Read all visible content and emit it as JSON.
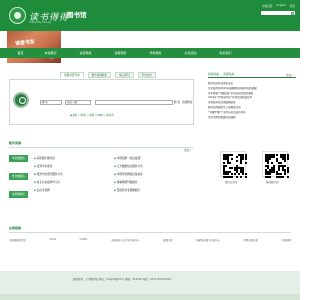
{
  "header": {
    "school_name_cn": "读书得得",
    "school_name_en": "University Library",
    "library_title": "图书馆",
    "top_links": [
      "学校首页",
      "English",
      "登录"
    ],
    "brand_color": "#1f8c3b"
  },
  "banner": {
    "text": "读者书友"
  },
  "nav": {
    "items": [
      "首页",
      "本馆概况",
      "资源导航",
      "读者服务",
      "学科服务",
      "文化活动",
      "联系我们"
    ]
  },
  "search": {
    "tabs": [
      "馆藏书目查询",
      "数字资源检索",
      "电子期刊",
      "学位论文"
    ],
    "field_select": "题 名",
    "match_select": "前方一致",
    "query_value": "",
    "go_label": "检 索",
    "adv_label": "高级检索",
    "types": "◉书名 ○作者 ○主题 ○ISBN ○索书号"
  },
  "digital_lib": {
    "title": "数字资源",
    "buttons": [
      "中文数据库",
      "外文数据库",
      "试用数据库"
    ],
    "more": "更多»",
    "items": [
      "超星数字图书馆",
      "中国知网（知识发现）",
      "读秀学术搜索",
      "万方数据知识服务平台",
      "维普中文期刊服务平台",
      "中国年鉴网络出版总库",
      "新东方多媒体学习库",
      "博看网期刊数据库",
      "起点考试网",
      "国道外文专题数据库"
    ]
  },
  "right": {
    "tabs": [
      "新闻动态",
      "资源动态"
    ],
    "more": "更多»",
    "news": [
      "图书馆召开读者座谈会",
      "关于图书馆2024年暑假期间开放时间的通知",
      "关于开展“书香校园”全民阅读活动的通知",
      "2024年“世界读书日”系列活动获奖名单",
      "读者服务月活动圆满结束",
      "图书馆开展新生入馆教育培训",
      "“书香伴我行”读书分享会成功举办",
      "关于试用新数据库的通知"
    ],
    "qr": [
      "微信公众号",
      "移动图书馆"
    ]
  },
  "friend_links": {
    "title": "友情链接",
    "links": [
      "中国国家图书馆",
      "CALIS",
      "CASHL",
      "中国高校人文社科文献中心",
      "省图书馆",
      "国家科技图书文献中心",
      "超星发现系统",
      "中国知网"
    ]
  },
  "footer": {
    "text": "版权所有：大学图书馆 地址：XX市XX路XX号 邮编：214205 电话：0510-XXXXXXXX"
  }
}
